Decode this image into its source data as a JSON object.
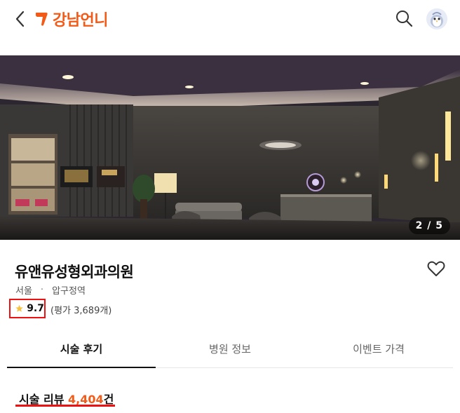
{
  "header": {
    "brand": "강남언니",
    "accent": "#f25a18"
  },
  "hero": {
    "counter": "2 / 5"
  },
  "clinic": {
    "name": "유앤유성형외과의원",
    "city": "서울",
    "area": "압구정역",
    "rating": "9.7",
    "review_count": "(평가 3,689개)"
  },
  "tabs": [
    {
      "label": "시술 후기",
      "active": true
    },
    {
      "label": "병원 정보",
      "active": false
    },
    {
      "label": "이벤트 가격",
      "active": false
    }
  ],
  "reviews": {
    "heading_prefix": "시술 리뷰 ",
    "count": "4,404",
    "suffix": "건"
  }
}
